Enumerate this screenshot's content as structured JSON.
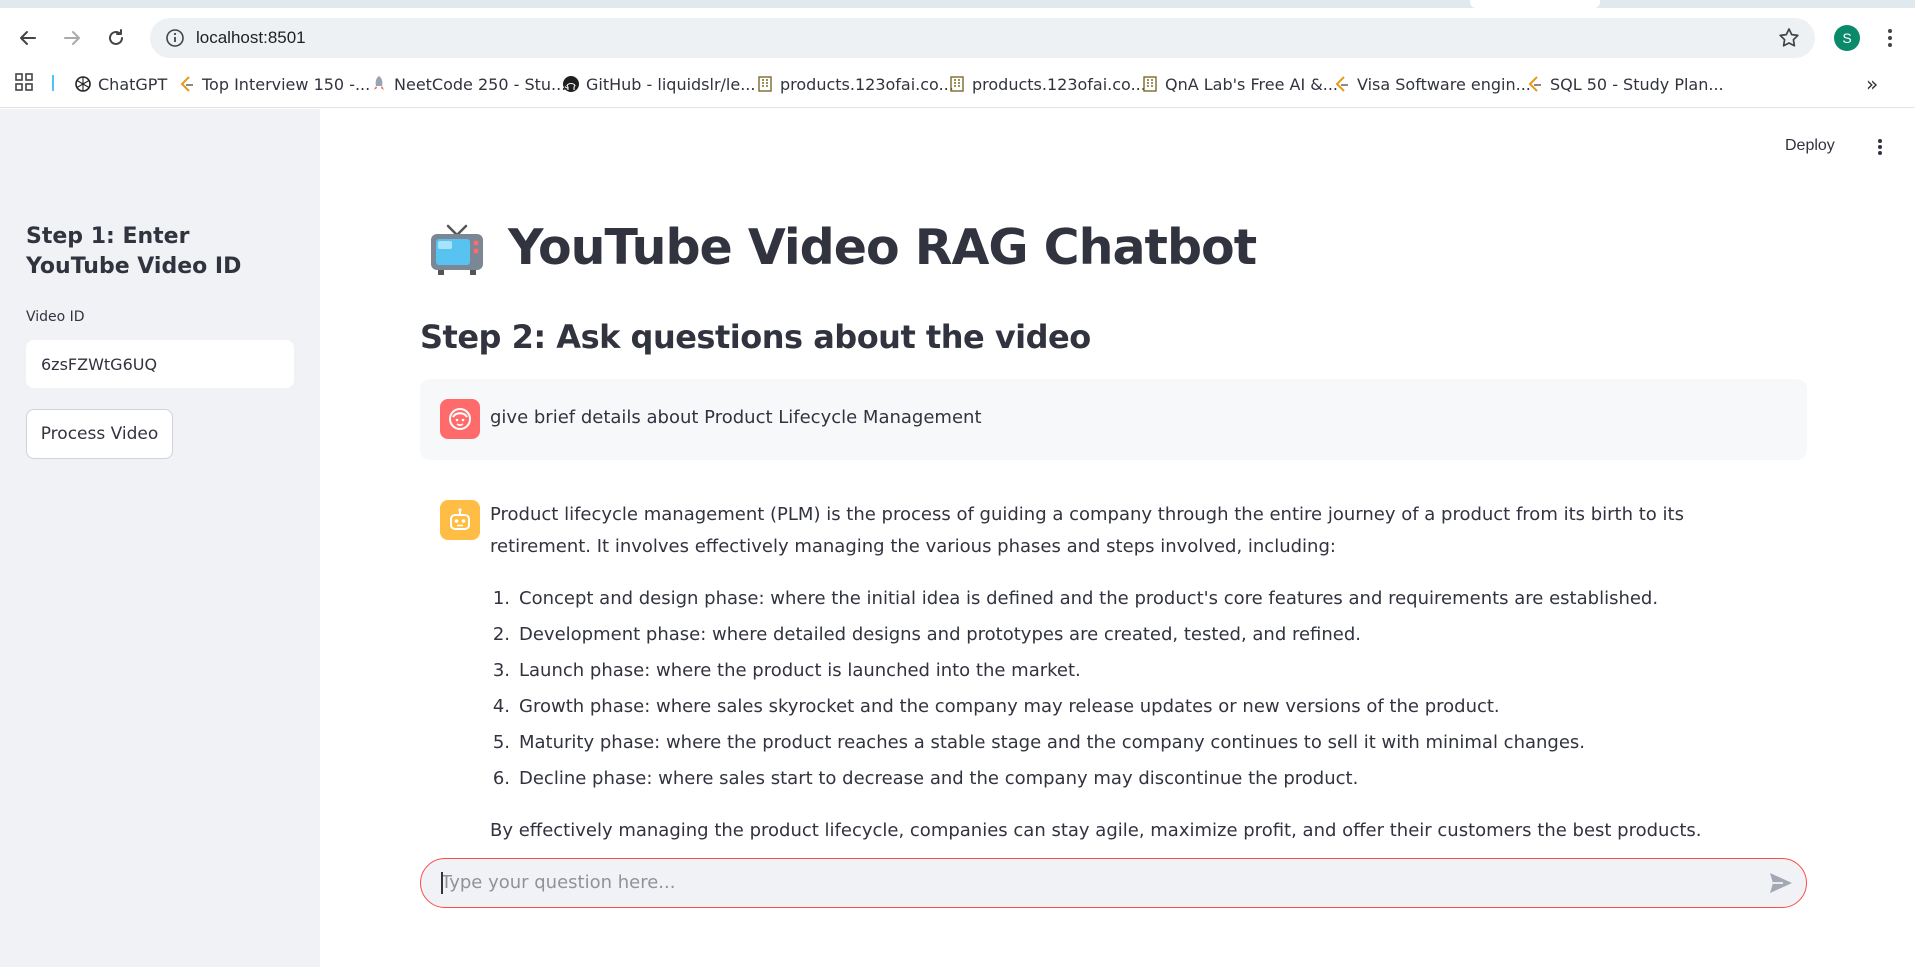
{
  "browser": {
    "url": "localhost:8501",
    "profile_initial": "S",
    "bookmarks": [
      {
        "label": "ChatGPT",
        "icon": "openai-icon"
      },
      {
        "label": "Top Interview 150 -...",
        "icon": "leetcode-icon"
      },
      {
        "label": "NeetCode 250 - Stu...",
        "icon": "rocket-icon"
      },
      {
        "label": "GitHub - liquidslr/le...",
        "icon": "github-icon"
      },
      {
        "label": "products.123ofai.co...",
        "icon": "building-icon"
      },
      {
        "label": "products.123ofai.co...",
        "icon": "building-icon"
      },
      {
        "label": "QnA Lab's Free AI &...",
        "icon": "building-icon"
      },
      {
        "label": "Visa Software engin...",
        "icon": "leetcode-icon"
      },
      {
        "label": "SQL 50 - Study Plan...",
        "icon": "leetcode-icon"
      }
    ],
    "more_bookmarks": "»"
  },
  "app": {
    "deploy_label": "Deploy",
    "sidebar": {
      "title": "Step 1: Enter YouTube Video ID",
      "video_id_label": "Video ID",
      "video_id_value": "6zsFZWtG6UQ",
      "process_button": "Process Video"
    },
    "main": {
      "title": "YouTube Video RAG Chatbot",
      "title_icon": "television-icon",
      "subheader": "Step 2: Ask questions about the video",
      "user_message": "give brief details about Product Lifecycle Management",
      "assistant_message": {
        "intro": "Product lifecycle management (PLM) is the process of guiding a company through the entire journey of a product from its birth to its retirement. It involves effectively managing the various phases and steps involved, including:",
        "items": [
          "Concept and design phase: where the initial idea is defined and the product's core features and requirements are established.",
          "Development phase: where detailed designs and prototypes are created, tested, and refined.",
          "Launch phase: where the product is launched into the market.",
          "Growth phase: where sales skyrocket and the company may release updates or new versions of the product.",
          "Maturity phase: where the product reaches a stable stage and the company continues to sell it with minimal changes.",
          "Decline phase: where sales start to decrease and the company may discontinue the product."
        ],
        "outro": "By effectively managing the product lifecycle, companies can stay agile, maximize profit, and offer their customers the best products."
      },
      "chat_input_placeholder": "Type your question here..."
    }
  },
  "colors": {
    "sidebar_bg": "#f0f2f6",
    "user_avatar": "#ff6b6b",
    "assistant_avatar": "#ffbd45",
    "focus_border": "#ff4b4b",
    "text": "#31333f"
  }
}
